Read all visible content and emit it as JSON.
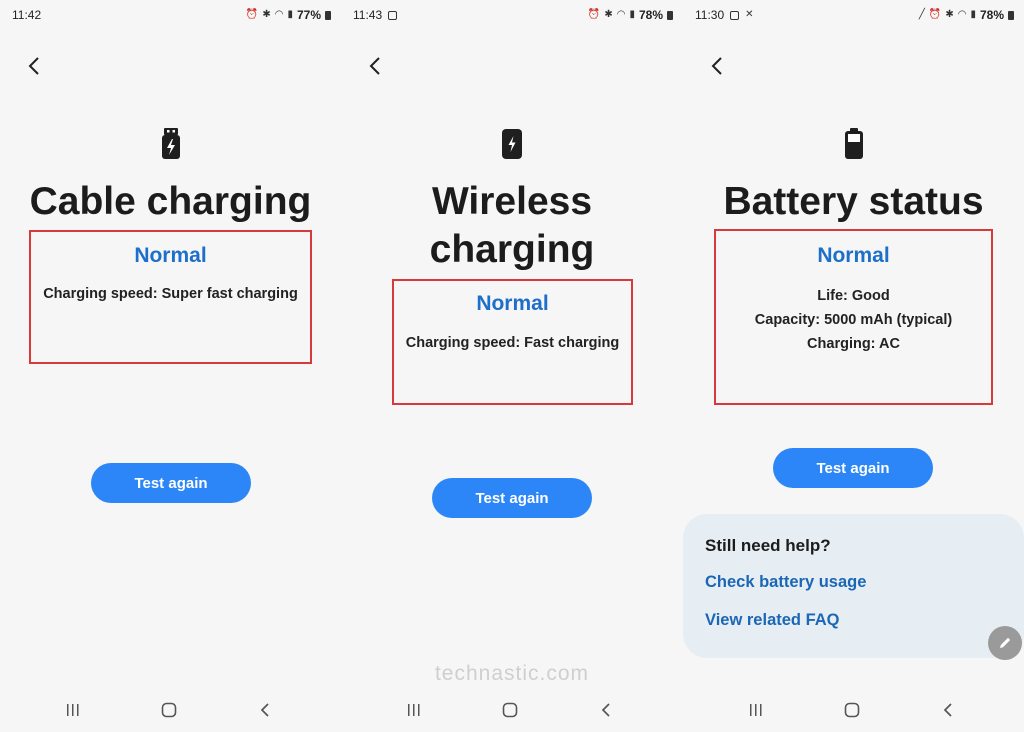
{
  "screens": [
    {
      "status_time": "11:42",
      "battery_percent": "77%",
      "title": "Cable charging",
      "hero_icon": "usb-charging-icon",
      "result_status": "Normal",
      "result_lines": [
        "Charging speed: Super fast charging"
      ],
      "button_label": "Test again"
    },
    {
      "status_time": "11:43",
      "battery_percent": "78%",
      "title": "Wireless charging",
      "title_lines": [
        "Wireless",
        "charging"
      ],
      "hero_icon": "wireless-charging-icon",
      "result_status": "Normal",
      "result_lines": [
        "Charging speed: Fast charging"
      ],
      "button_label": "Test again"
    },
    {
      "status_time": "11:30",
      "battery_percent": "78%",
      "title": "Battery status",
      "hero_icon": "battery-icon",
      "result_status": "Normal",
      "result_lines": [
        "Life: Good",
        "Capacity: 5000 mAh (typical)",
        "Charging: AC"
      ],
      "button_label": "Test again",
      "help": {
        "title": "Still need help?",
        "links": [
          "Check battery usage",
          "View related FAQ"
        ]
      }
    }
  ],
  "watermark": "technastic.com",
  "colors": {
    "accent": "#2d86f7",
    "status_text": "#1d6fc9",
    "highlight_border": "#d63a3a",
    "help_card_bg": "#e6eef4"
  }
}
